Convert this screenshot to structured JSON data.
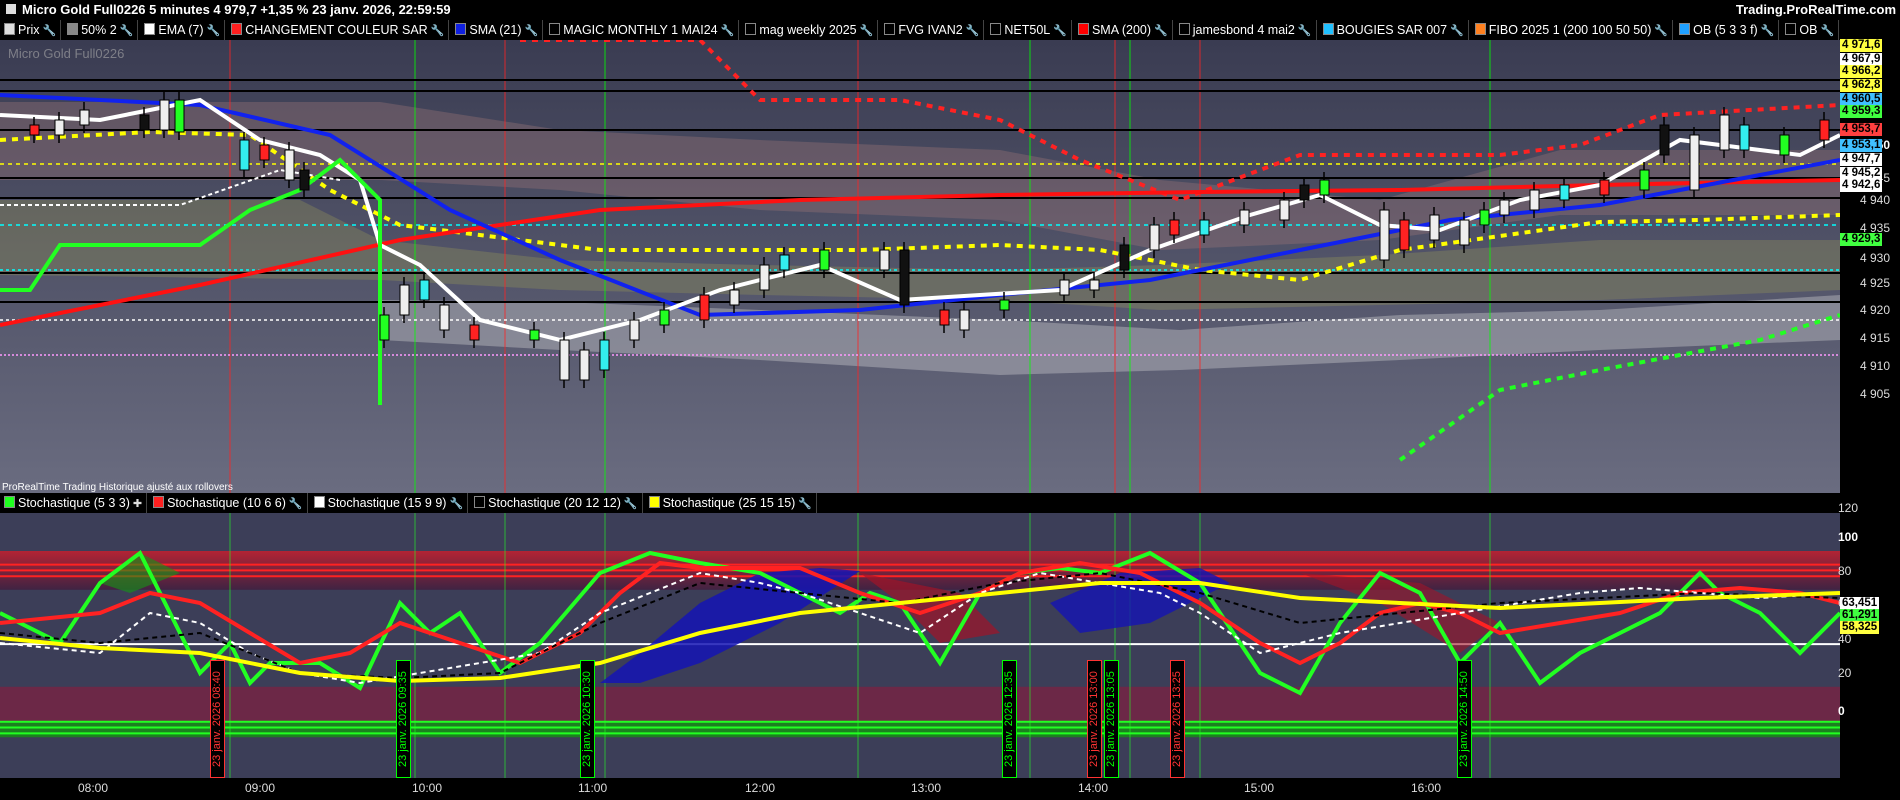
{
  "window": {
    "title": "Micro Gold Full0226 5 minutes 4 979,7 +1,35 % 23 janv. 2026, 22:59:59",
    "site": "Trading.ProRealTime.com"
  },
  "indicators": [
    {
      "label": "Prix",
      "color": "#dddddd"
    },
    {
      "label": "50% 2",
      "color": "#888888"
    },
    {
      "label": "EMA (7)",
      "color": "#ffffff"
    },
    {
      "label": "CHANGEMENT COULEUR SAR",
      "color": "#ff2020"
    },
    {
      "label": "SMA (21)",
      "color": "#1020e0"
    },
    {
      "label": "MAGIC MONTHLY 1 MAI24",
      "color": "#000000"
    },
    {
      "label": "mag weekly 2025",
      "color": "#000000"
    },
    {
      "label": "FVG IVAN2",
      "color": "#000000"
    },
    {
      "label": "NET50L",
      "color": "#000000"
    },
    {
      "label": "SMA (200)",
      "color": "#ff0000"
    },
    {
      "label": "jamesbond 4 mai2",
      "color": "#000000"
    },
    {
      "label": "BOUGIES SAR 007",
      "color": "#20c0ff"
    },
    {
      "label": "FIBO 2025 1 (200 100 50 50)",
      "color": "#ff8020"
    },
    {
      "label": "OB (5 3 3 f)",
      "color": "#20a0ff"
    },
    {
      "label": "OB",
      "color": "#000000"
    }
  ],
  "main_chart": {
    "instrument_label": "Micro Gold Full0226",
    "footer_note": "ProRealTime Trading  Historique ajusté aux rollovers"
  },
  "oscillators": [
    {
      "label": "Stochastique (5 3 3)",
      "color": "#20ff20"
    },
    {
      "label": "Stochastique (10 6 6)",
      "color": "#ff2020"
    },
    {
      "label": "Stochastique (15 9 9)",
      "color": "#ffffff"
    },
    {
      "label": "Stochastique (20 12 12)",
      "color": "#000000"
    },
    {
      "label": "Stochastique (25 15 15)",
      "color": "#ffff00"
    }
  ],
  "price_axis": {
    "ticks": [
      "4 950",
      "4 945",
      "4 940",
      "4 935",
      "4 930",
      "4 925",
      "4 920",
      "4 915",
      "4 910",
      "4 905"
    ],
    "labels": [
      {
        "text": "4 971,6",
        "bg": "#ffff40"
      },
      {
        "text": "4 967,9",
        "bg": "#ffffff"
      },
      {
        "text": "4 966,2",
        "bg": "#ffff40"
      },
      {
        "text": "4 962,8",
        "bg": "#ffff40"
      },
      {
        "text": "4 960,5",
        "bg": "#40c0ff"
      },
      {
        "text": "4 959,3",
        "bg": "#40ff40"
      },
      {
        "text": "4 953,7",
        "bg": "#ff4040"
      },
      {
        "text": "4 953,1",
        "bg": "#40c0ff"
      },
      {
        "text": "4 947,7",
        "bg": "#ffffff"
      },
      {
        "text": "4 945,2",
        "bg": "#ffffff"
      },
      {
        "text": "4 942,6",
        "bg": "#ffffff"
      },
      {
        "text": "4 929,3",
        "bg": "#40ff40"
      }
    ]
  },
  "osc_axis": {
    "ticks": [
      "120",
      "100",
      "80",
      "60",
      "40",
      "20",
      "0"
    ],
    "labels": [
      {
        "text": "63,451",
        "bg": "#ffffff"
      },
      {
        "text": "61,291",
        "bg": "#40ff40"
      },
      {
        "text": "58,325",
        "bg": "#ffff40"
      }
    ]
  },
  "time_axis": {
    "ticks": [
      "08:00",
      "09:00",
      "10:00",
      "11:00",
      "12:00",
      "13:00",
      "14:00",
      "15:00",
      "16:00"
    ]
  },
  "time_tags": [
    {
      "text": "23 janv. 2026 08:40",
      "color": "red"
    },
    {
      "text": "23 janv. 2026 09:35",
      "color": "green"
    },
    {
      "text": "23 janv. 2026 10:30",
      "color": "green"
    },
    {
      "text": "23 janv. 2026 12:35",
      "color": "green"
    },
    {
      "text": "23 janv. 2026 13:00",
      "color": "red"
    },
    {
      "text": "23 janv. 2026 13:05",
      "color": "green"
    },
    {
      "text": "23 janv. 2026 13:25",
      "color": "red"
    },
    {
      "text": "23 janv. 2026 14:50",
      "color": "green"
    }
  ]
}
